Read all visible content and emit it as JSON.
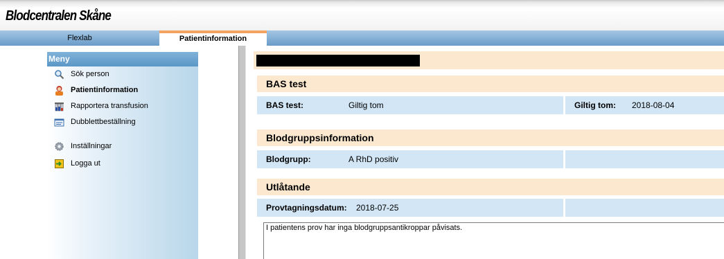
{
  "app": {
    "title": "Blodcentralen Skåne"
  },
  "tabs": [
    {
      "label": "Flexlab",
      "active": false
    },
    {
      "label": "Patientinformation",
      "active": true
    }
  ],
  "menu": {
    "header": "Meny",
    "items": [
      {
        "label": "Sök person",
        "icon": "magnifier-icon"
      },
      {
        "label": "Patientinformation",
        "icon": "patient-icon",
        "active": true
      },
      {
        "label": "Rapportera transfusion",
        "icon": "blood-tubes-icon"
      },
      {
        "label": "Dubblettbeställning",
        "icon": "duplicate-order-icon"
      },
      {
        "label": "Inställningar",
        "icon": "gear-icon"
      },
      {
        "label": "Logga ut",
        "icon": "logout-icon"
      }
    ]
  },
  "sections": {
    "bas": {
      "title": "BAS test",
      "label": "BAS test:",
      "value": "Giltig tom",
      "valid_label": "Giltig tom:",
      "valid_value": "2018-08-04"
    },
    "blood": {
      "title": "Blodgruppsinformation",
      "label": "Blodgrupp:",
      "value": "A RhD positiv"
    },
    "statement": {
      "title": "Utlåtande",
      "label": "Provtagningsdatum:",
      "value": "2018-07-25",
      "text": "I patientens prov har inga blodgruppsantikroppar påvisats."
    }
  },
  "colors": {
    "section_bg": "#fbe8cf",
    "row_bg": "#d2e6f5",
    "tab_accent": "#f4a460",
    "menu_header": "#5b97c7"
  }
}
